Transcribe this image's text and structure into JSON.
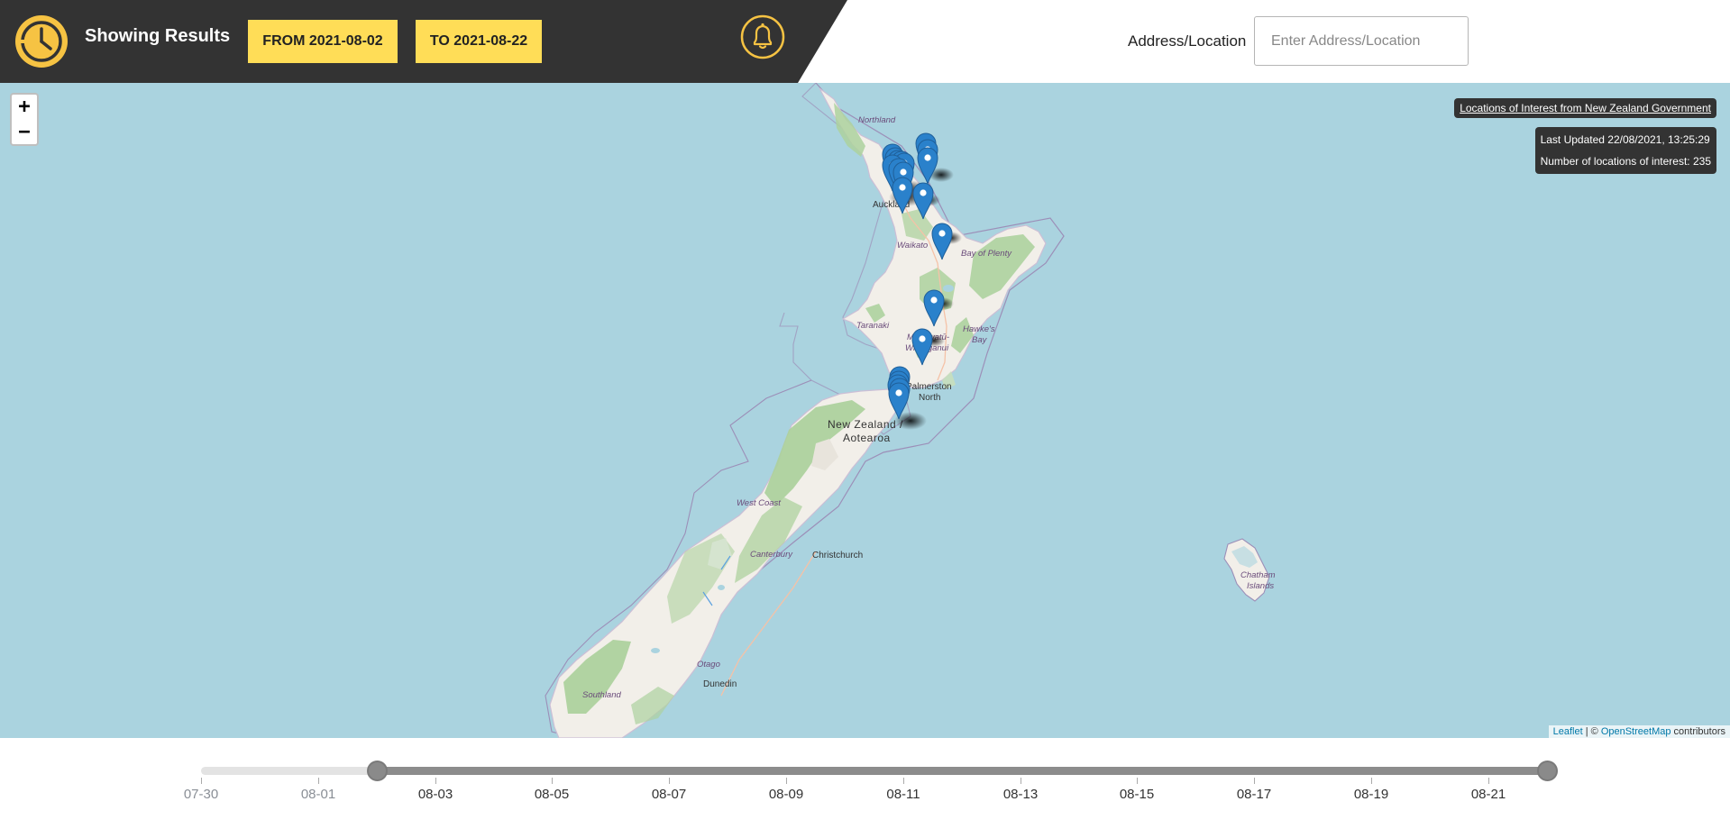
{
  "header": {
    "title": "Showing Results",
    "from_label": "FROM 2021-08-02",
    "to_label": "TO 2021-08-22",
    "address_label": "Address/Location",
    "address_placeholder": "Enter Address/Location",
    "address_value": ""
  },
  "map": {
    "zoom_in": "+",
    "zoom_out": "−",
    "loi_link": "Locations of Interest from New Zealand Government",
    "last_updated": "Last Updated 22/08/2021, 13:25:29",
    "location_count": "Number of locations of interest: 235",
    "attribution_leaflet": "Leaflet",
    "attribution_sep": " | © ",
    "attribution_osm": "OpenStreetMap",
    "attribution_tail": " contributors",
    "labels": {
      "northland": "Northland",
      "auckland": "Auckland",
      "waikato": "Waikato",
      "bay_of_plenty": "Bay of Plenty",
      "taranaki": "Taranaki",
      "hawkes_bay_1": "Hawke's",
      "hawkes_bay_2": "Bay",
      "manawatu_1": "Manawatū-",
      "manawatu_2": "Whanganui",
      "palmerston_1": "Palmerston",
      "palmerston_2": "North",
      "nz_1": "New Zealand /",
      "nz_2": "Aotearoa",
      "west_coast": "West Coast",
      "canterbury": "Canterbury",
      "christchurch": "Christchurch",
      "otago": "Otago",
      "dunedin": "Dunedin",
      "southland": "Southland",
      "chatham_1": "Chatham",
      "chatham_2": "Islands"
    },
    "colors": {
      "sea": "#aad3df",
      "land": "#f2efe9",
      "forest": "#add19e",
      "marker": "#2a81cb"
    }
  },
  "slider": {
    "ticks": [
      {
        "label": "07-30",
        "dim": true
      },
      {
        "label": "08-01",
        "dim": true
      },
      {
        "label": "08-03",
        "dim": false
      },
      {
        "label": "08-05",
        "dim": false
      },
      {
        "label": "08-07",
        "dim": false
      },
      {
        "label": "08-09",
        "dim": false
      },
      {
        "label": "08-11",
        "dim": false
      },
      {
        "label": "08-13",
        "dim": false
      },
      {
        "label": "08-15",
        "dim": false
      },
      {
        "label": "08-17",
        "dim": false
      },
      {
        "label": "08-19",
        "dim": false
      },
      {
        "label": "08-21",
        "dim": false
      }
    ],
    "range_start": "2021-08-02",
    "range_end": "2021-08-22"
  }
}
